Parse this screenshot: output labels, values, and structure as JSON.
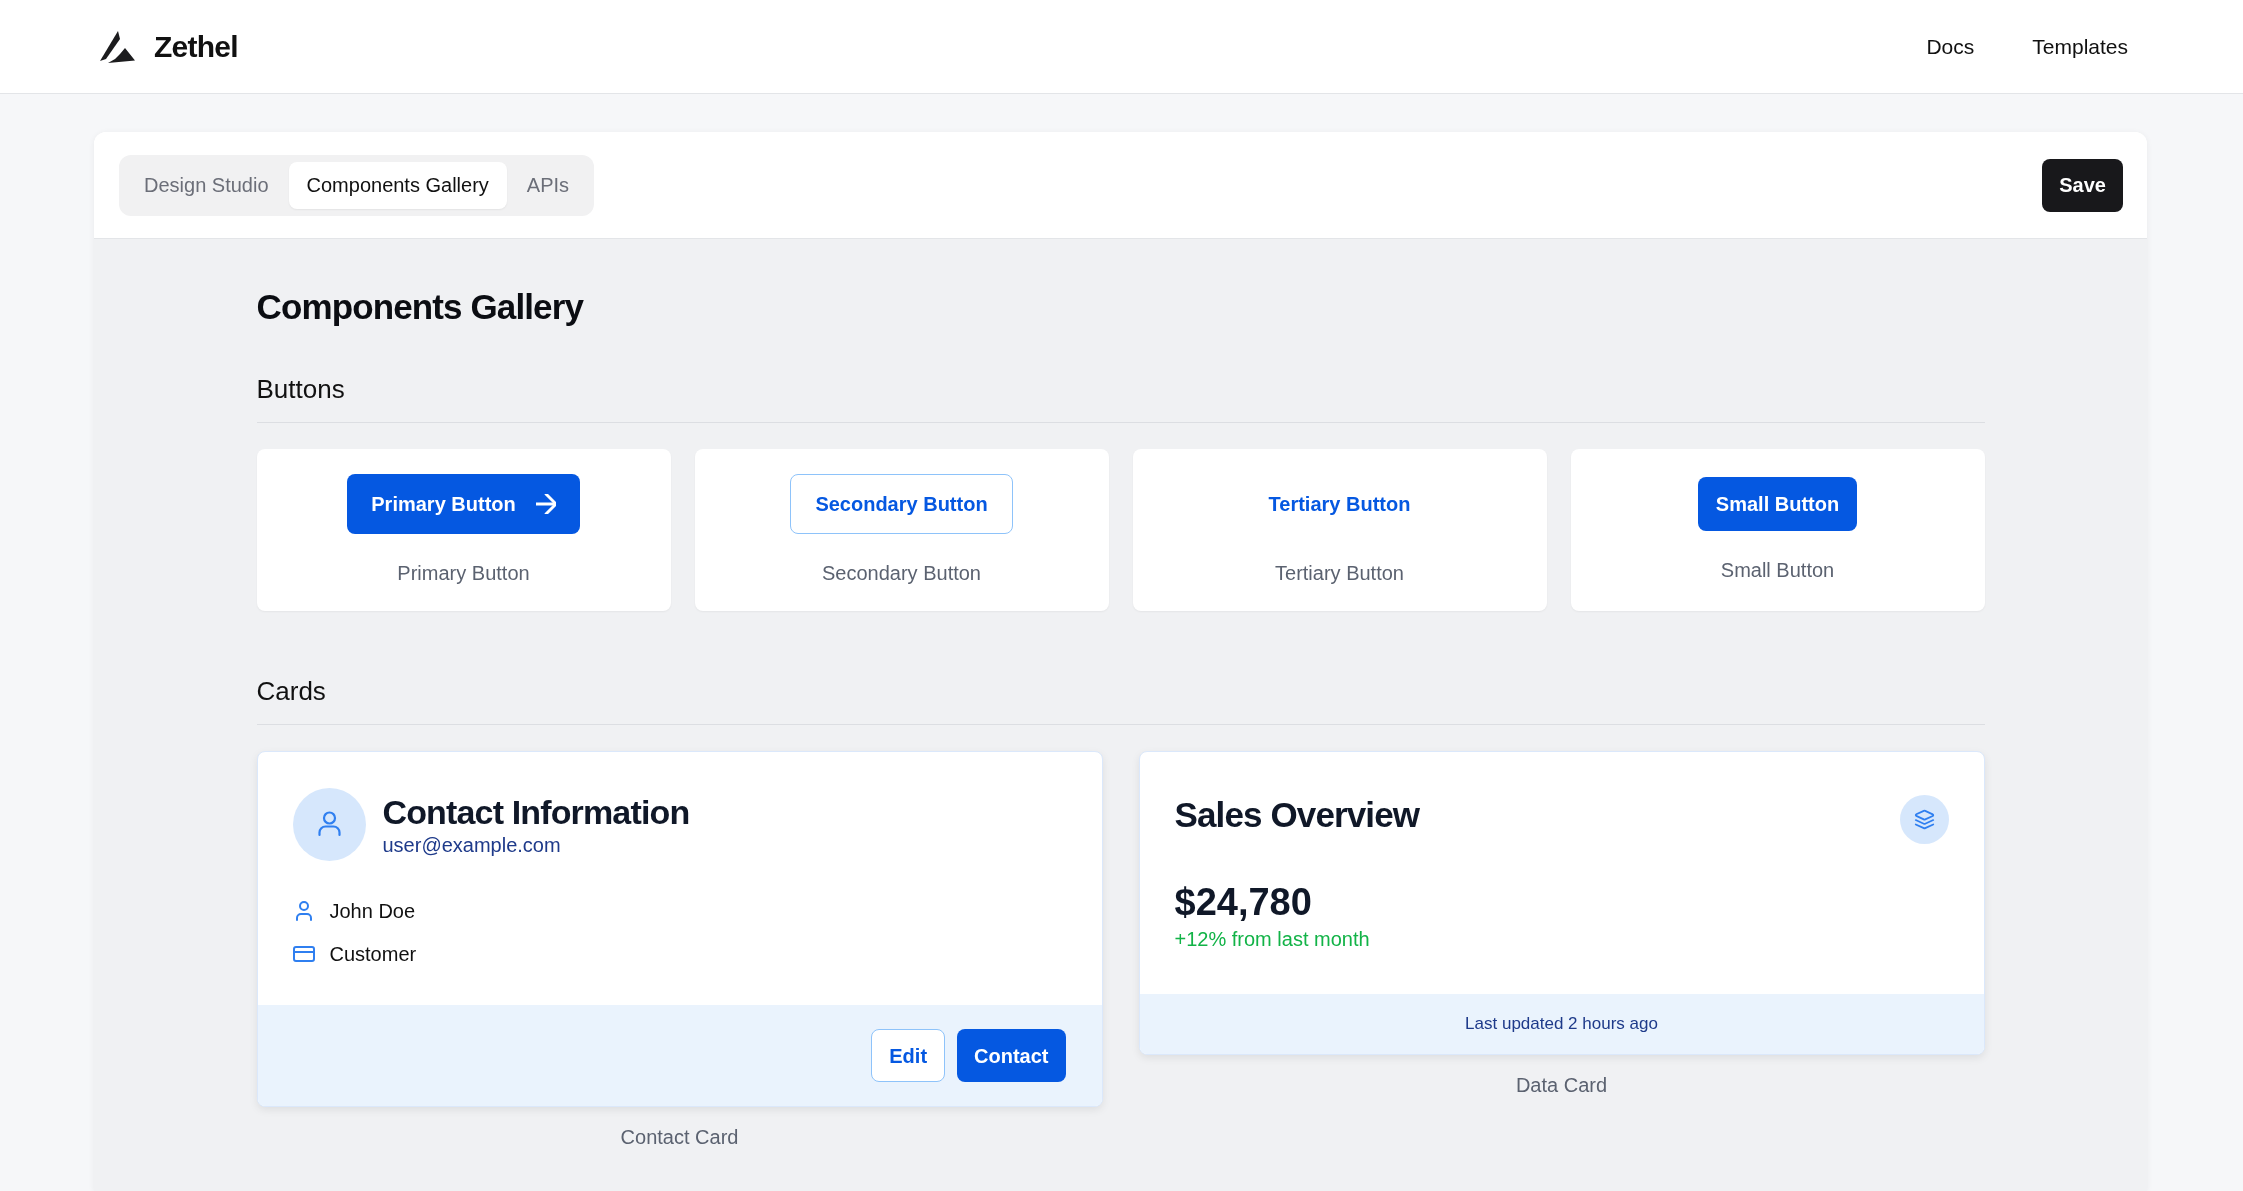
{
  "header": {
    "brand": "Zethel",
    "nav": [
      {
        "label": "Docs"
      },
      {
        "label": "Templates"
      }
    ]
  },
  "toolbar": {
    "tabs": [
      {
        "label": "Design Studio",
        "selected": false
      },
      {
        "label": "Components Gallery",
        "selected": true
      },
      {
        "label": "APIs",
        "selected": false
      }
    ],
    "save_button": "Save"
  },
  "page_title": "Components Gallery",
  "sections": [
    {
      "kind": "buttons",
      "heading": "Buttons",
      "items": [
        {
          "kind": "primary",
          "label": "Primary Button",
          "caption": "Primary Button"
        },
        {
          "kind": "secondary",
          "label": "Secondary Button",
          "caption": "Secondary Button"
        },
        {
          "kind": "tertiary",
          "label": "Tertiary Button",
          "caption": "Tertiary Button"
        },
        {
          "kind": "small",
          "label": "Small Button",
          "caption": "Small Button"
        }
      ]
    },
    {
      "kind": "cards",
      "heading": "Cards",
      "items": [
        {
          "kind": "contact",
          "title": "Contact Information",
          "email": "user@example.com",
          "details": [
            {
              "kind": "name",
              "text": "John Doe"
            },
            {
              "kind": "account_type",
              "text": "Customer"
            }
          ],
          "actions": [
            {
              "kind": "outline",
              "label": "Edit"
            },
            {
              "kind": "solid",
              "label": "Contact"
            }
          ],
          "caption": "Contact Card"
        },
        {
          "kind": "data",
          "title": "Sales Overview",
          "value": "$24,780",
          "change": "+12% from last month",
          "footer": "Last updated 2 hours ago",
          "caption": "Data Card"
        }
      ]
    }
  ]
}
